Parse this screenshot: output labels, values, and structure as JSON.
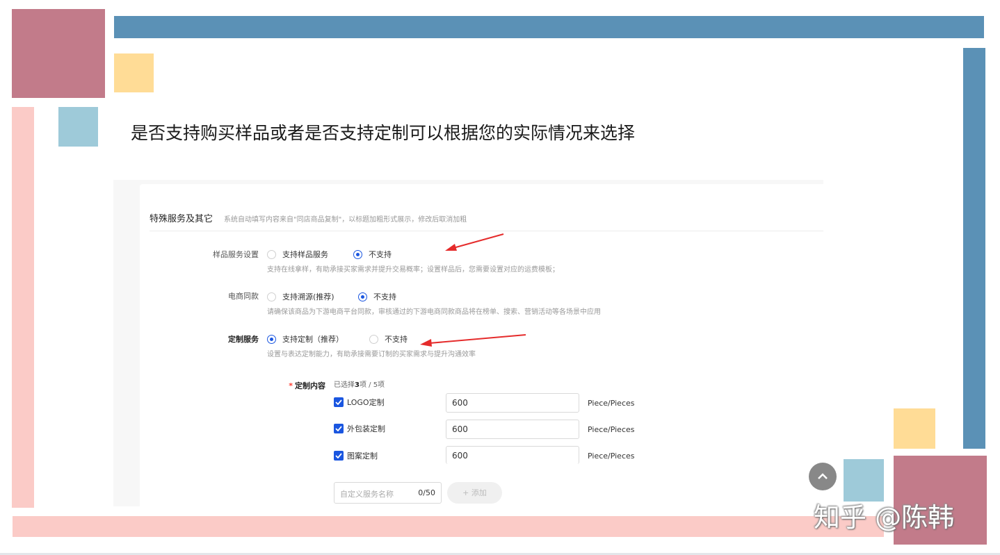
{
  "slide": {
    "title": "是否支持购买样品或者是否支持定制可以根据您的实际情况来选择",
    "colors": {
      "rose": "#c27b8a",
      "yellow": "#ffdc96",
      "light_blue": "#9ecad9",
      "pink": "#fbcbc7",
      "steel_blue": "#5b91b6"
    }
  },
  "form": {
    "section_title": "特殊服务及其它",
    "section_note": "系统自动填写内容来自\"同店商品复制\"，以标题加粗形式展示，修改后取消加粗",
    "sample_service": {
      "label": "样品服务设置",
      "options": [
        {
          "label": "支持样品服务",
          "selected": false
        },
        {
          "label": "不支持",
          "selected": true
        }
      ],
      "hint": "支持在线拿样，有助承接买家需求并提升交易概率；设置样品后，您需要设置对应的运费模板；"
    },
    "ecommerce_same": {
      "label": "电商同款",
      "options": [
        {
          "label": "支持溯源(推荐)",
          "selected": false
        },
        {
          "label": "不支持",
          "selected": true
        }
      ],
      "hint": "请确保该商品为下游电商平台同款，审核通过的下游电商同款商品将在榜单、搜索、营销活动等各场景中应用"
    },
    "custom_service": {
      "label": "定制服务",
      "options": [
        {
          "label": "支持定制（推荐）",
          "selected": true
        },
        {
          "label": "不支持",
          "selected": false
        }
      ],
      "hint": "设置与表达定制能力，有助承接需要订制的买家需求与提升沟通效率"
    },
    "custom_content": {
      "required_mark": "*",
      "label": "定制内容",
      "summary_prefix": "已选择",
      "summary_count": "3",
      "summary_suffix": "项 / 5项",
      "items": [
        {
          "label": "LOGO定制",
          "checked": true,
          "quantity": "600",
          "unit": "Piece/Pieces"
        },
        {
          "label": "外包装定制",
          "checked": true,
          "quantity": "600",
          "unit": "Piece/Pieces"
        },
        {
          "label": "图案定制",
          "checked": true,
          "quantity": "600",
          "unit": "Piece/Pieces"
        }
      ],
      "custom_name_placeholder": "自定义服务名称",
      "custom_name_count": "0/50",
      "add_label": "+ 添加"
    },
    "accent_color": "#1a56e0",
    "annotation_color": "#e52b2b"
  },
  "watermark": "知乎 @陈韩"
}
